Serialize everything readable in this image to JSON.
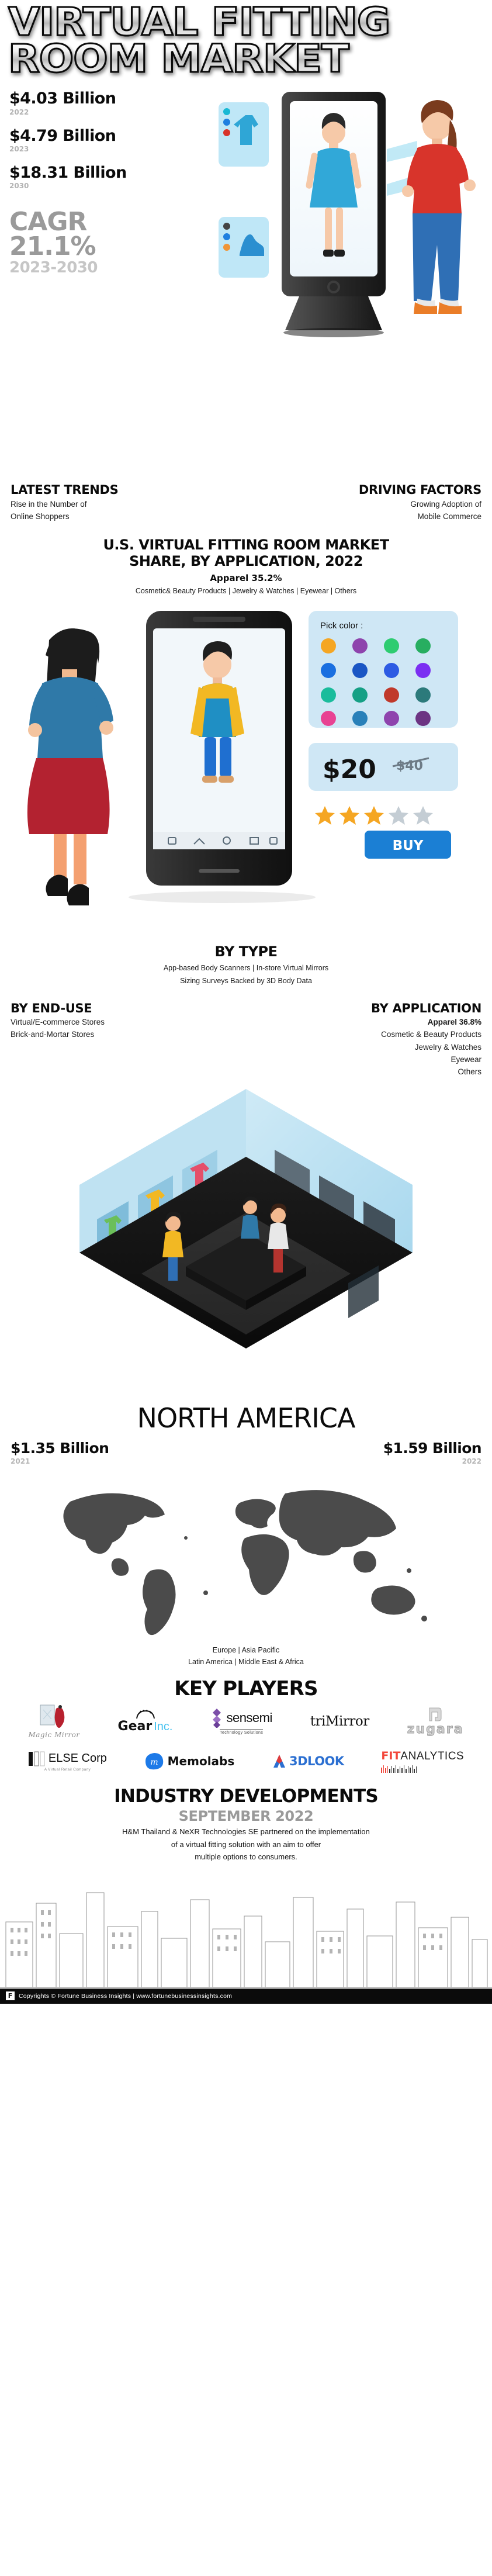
{
  "title": {
    "line1": "VIRTUAL FITTING",
    "line2": "ROOM MARKET"
  },
  "hero": {
    "stats": [
      {
        "value": "$4.03 Billion",
        "year": "2022"
      },
      {
        "value": "$4.79 Billion",
        "year": "2023"
      },
      {
        "value": "$18.31 Billion",
        "year": "2030"
      }
    ],
    "cagr": {
      "label": "CAGR",
      "value": "21.1%",
      "range": "2023-2030"
    }
  },
  "trends": {
    "heading": "LATEST TRENDS",
    "line1": "Rise in the Number of",
    "line2": "Online Shoppers"
  },
  "drivers": {
    "heading": "DRIVING FACTORS",
    "line1": "Growing Adoption of",
    "line2": "Mobile Commerce"
  },
  "us_share": {
    "heading_line1": "U.S. VIRTUAL FITTING ROOM MARKET",
    "heading_line2": "SHARE, BY APPLICATION, 2022",
    "leader": "Apparel 35.2%",
    "segments": "Cosmetic& Beauty Products  |  Jewelry & Watches  |  Eyewear  |  Others"
  },
  "phone_scene": {
    "pick_color_label": "Pick color :",
    "price": "$20",
    "old_price": "$40",
    "buy_label": "BUY",
    "swatch_colors": [
      "#f5a623",
      "#8e44ad",
      "#2ecc71",
      "#27ae60",
      "#1a6fe0",
      "#1a56c4",
      "#2d5be3",
      "#7b2ff2",
      "#1abc9c",
      "#16a085",
      "#c0392b",
      "#2c7a7b",
      "#e84393",
      "#2980b9",
      "#8e44ad",
      "#6c3483"
    ],
    "star_count": 5,
    "stars_filled": 3
  },
  "by_type": {
    "heading": "BY TYPE",
    "line1": "App-based Body Scanners  |  In-store Virtual Mirrors",
    "line2": "Sizing Surveys Backed by 3D Body Data"
  },
  "by_end_use": {
    "heading": "BY END-USE",
    "items": [
      "Virtual/E-commerce Stores",
      "Brick-and-Mortar Stores"
    ]
  },
  "by_application": {
    "heading": "BY APPLICATION",
    "leader": "Apparel 36.8%",
    "items": [
      "Cosmetic & Beauty Products",
      "Jewelry & Watches",
      "Eyewear",
      "Others"
    ]
  },
  "region": {
    "title": "NORTH AMERICA",
    "left": {
      "value": "$1.35 Billion",
      "year": "2021"
    },
    "right": {
      "value": "$1.59 Billion",
      "year": "2022"
    },
    "other_regions_line1": "Europe  |  Asia Pacific",
    "other_regions_line2": "Latin America  |  Middle East & Africa"
  },
  "key_players": {
    "heading": "KEY PLAYERS",
    "row1": [
      {
        "name": "Magic Mirror",
        "tagline": ""
      },
      {
        "name": "Gear",
        "name2": "Inc.",
        "tagline": ""
      },
      {
        "name": "sensemi",
        "tagline": "Technology Solutions"
      },
      {
        "name": "triMirror",
        "tagline": ""
      },
      {
        "name": "zugara",
        "tagline": ""
      }
    ],
    "row2": [
      {
        "name": "ELSE Corp",
        "tagline": "A Virtual Retail Company"
      },
      {
        "name": "Memolabs",
        "tagline": ""
      },
      {
        "name": "3DLOOK",
        "tagline": ""
      },
      {
        "name": "FIT",
        "name2": "ANALYTICS",
        "tagline": ""
      }
    ]
  },
  "developments": {
    "heading": "INDUSTRY DEVELOPMENTS",
    "date": "SEPTEMBER 2022",
    "body_line1": "H&M Thailand & NeXR Technologies SE partnered on the implementation",
    "body_line2": "of a virtual fitting solution with an aim to offer",
    "body_line3": "multiple options to consumers."
  },
  "footer": {
    "logo_glyph": "F",
    "text": "Copyrights © Fortune Business Insights | www.fortunebusinessinsights.com"
  },
  "colors": {
    "accent_blue": "#45c2f0",
    "brand_red": "#f2463a",
    "muted_gray": "#9a9a9a"
  }
}
